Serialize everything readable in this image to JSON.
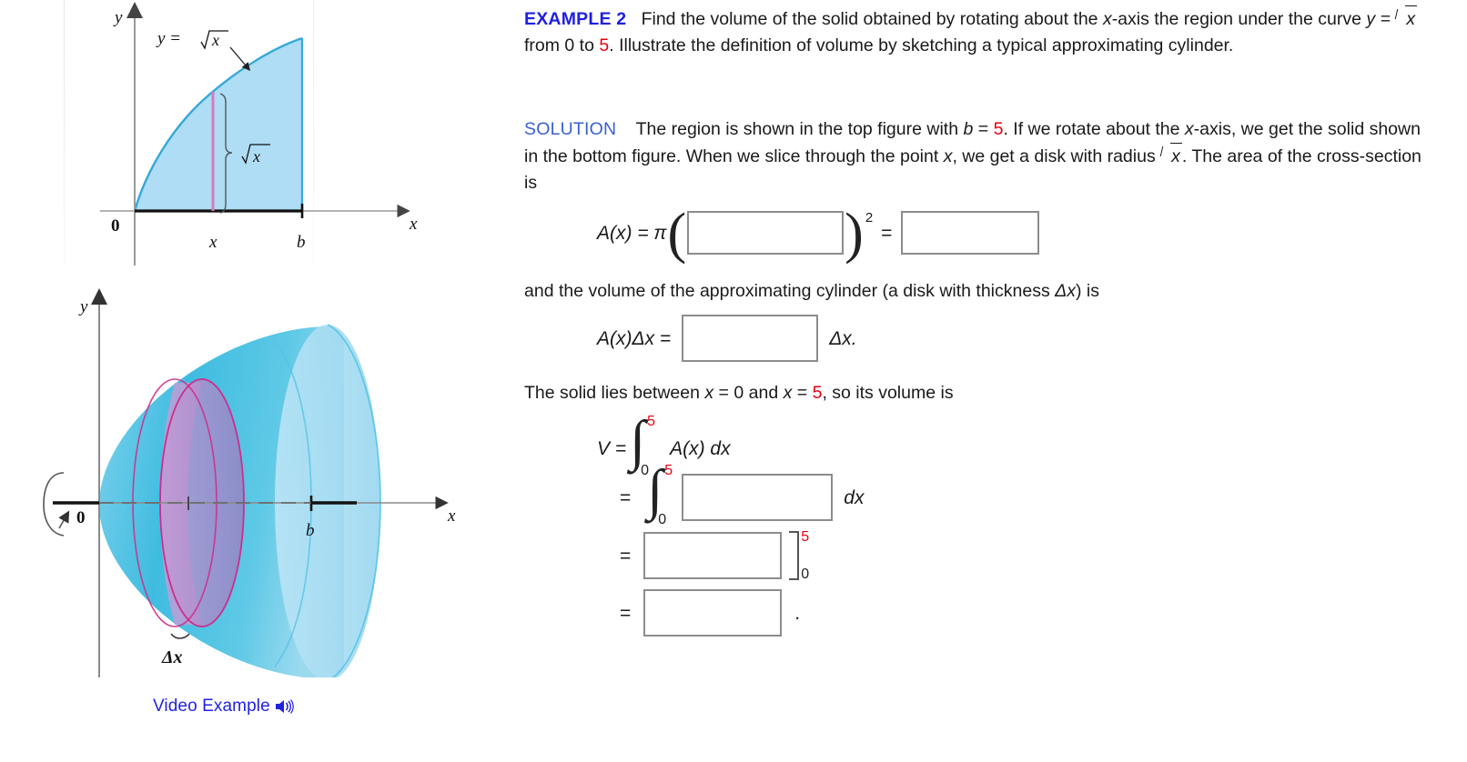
{
  "example": {
    "heading": "EXAMPLE 2",
    "text_1": "Find the volume of the solid obtained by rotating about the ",
    "x_axis_1": "x",
    "text_2": "-axis the region under the curve ",
    "y_eq": "y =",
    "radicand": "x",
    "text_3": " from 0 to ",
    "upper_limit": "5",
    "text_4": ". Illustrate the definition of volume by sketching a typical approximating cylinder."
  },
  "solution": {
    "heading": "SOLUTION",
    "text_1": "The region is shown in the top figure with ",
    "b_var": "b",
    "equals": " = ",
    "b_value": "5",
    "text_2": ". If we rotate about the ",
    "x_axis": "x",
    "text_3": "-axis, we get the solid shown in the bottom figure. When we slice through the point ",
    "x_var": "x",
    "text_4": ", we get a disk with radius ",
    "radicand": "x",
    "text_5": ". The area of the cross-section is"
  },
  "equations": {
    "area": {
      "lhs": "A(x)  =  π",
      "exponent": "2",
      "equals": "=",
      "box1_value": "",
      "box2_value": ""
    },
    "volume_cylinder_text": {
      "part_1": "and the volume of the approximating cylinder (a disk with thickness  ",
      "delta_x": "Δx",
      "part_2": ")  is"
    },
    "cylinder": {
      "lhs": "A(x)Δx  =",
      "box_value": "",
      "trailing": "Δx."
    },
    "lies_between": {
      "part_1": "The solid lies between  ",
      "x1": "x",
      "eq1": " = ",
      "v1": "0",
      "part_2": "  and  ",
      "x2": "x",
      "eq2": " = ",
      "v2": "5",
      "part_3": ",  so its volume is"
    },
    "volume_line_1": {
      "lhs": "V  =",
      "upper": "5",
      "lower": "0",
      "integrand": "A(x) dx"
    },
    "volume_line_2": {
      "equals": "=",
      "upper": "5",
      "lower": "0",
      "box_value": "",
      "trailing": "dx"
    },
    "volume_line_3": {
      "equals": "=",
      "box_value": "",
      "bracket_upper": "5",
      "bracket_lower": "0"
    },
    "volume_line_4": {
      "equals": "=",
      "box_value": "",
      "trailing": "."
    }
  },
  "figure_top": {
    "y_axis_label": "y",
    "x_axis_label": "x",
    "origin_label": "0",
    "curve_label_prefix": "y =",
    "curve_label_radicand": "x",
    "tick_x_label": "x",
    "tick_b_label": "b",
    "height_label_radicand": "x",
    "fill_color": "#AEDDF5",
    "curve_color": "#35A8D8",
    "slice_color": "#D87BC0"
  },
  "figure_bottom": {
    "y_axis_label": "y",
    "x_axis_label": "x",
    "origin_label": "0",
    "tick_b_label": "b",
    "thickness_label": "Δx",
    "solid_color": "#3FBCE0",
    "solid_light_color": "#A9DCF2",
    "disk_color": "#B57FC4",
    "disk_edge_color": "#CE2D8C"
  },
  "video_example": {
    "label": "Video Example",
    "icon": "speaker-icon",
    "color": "#2222dd"
  }
}
